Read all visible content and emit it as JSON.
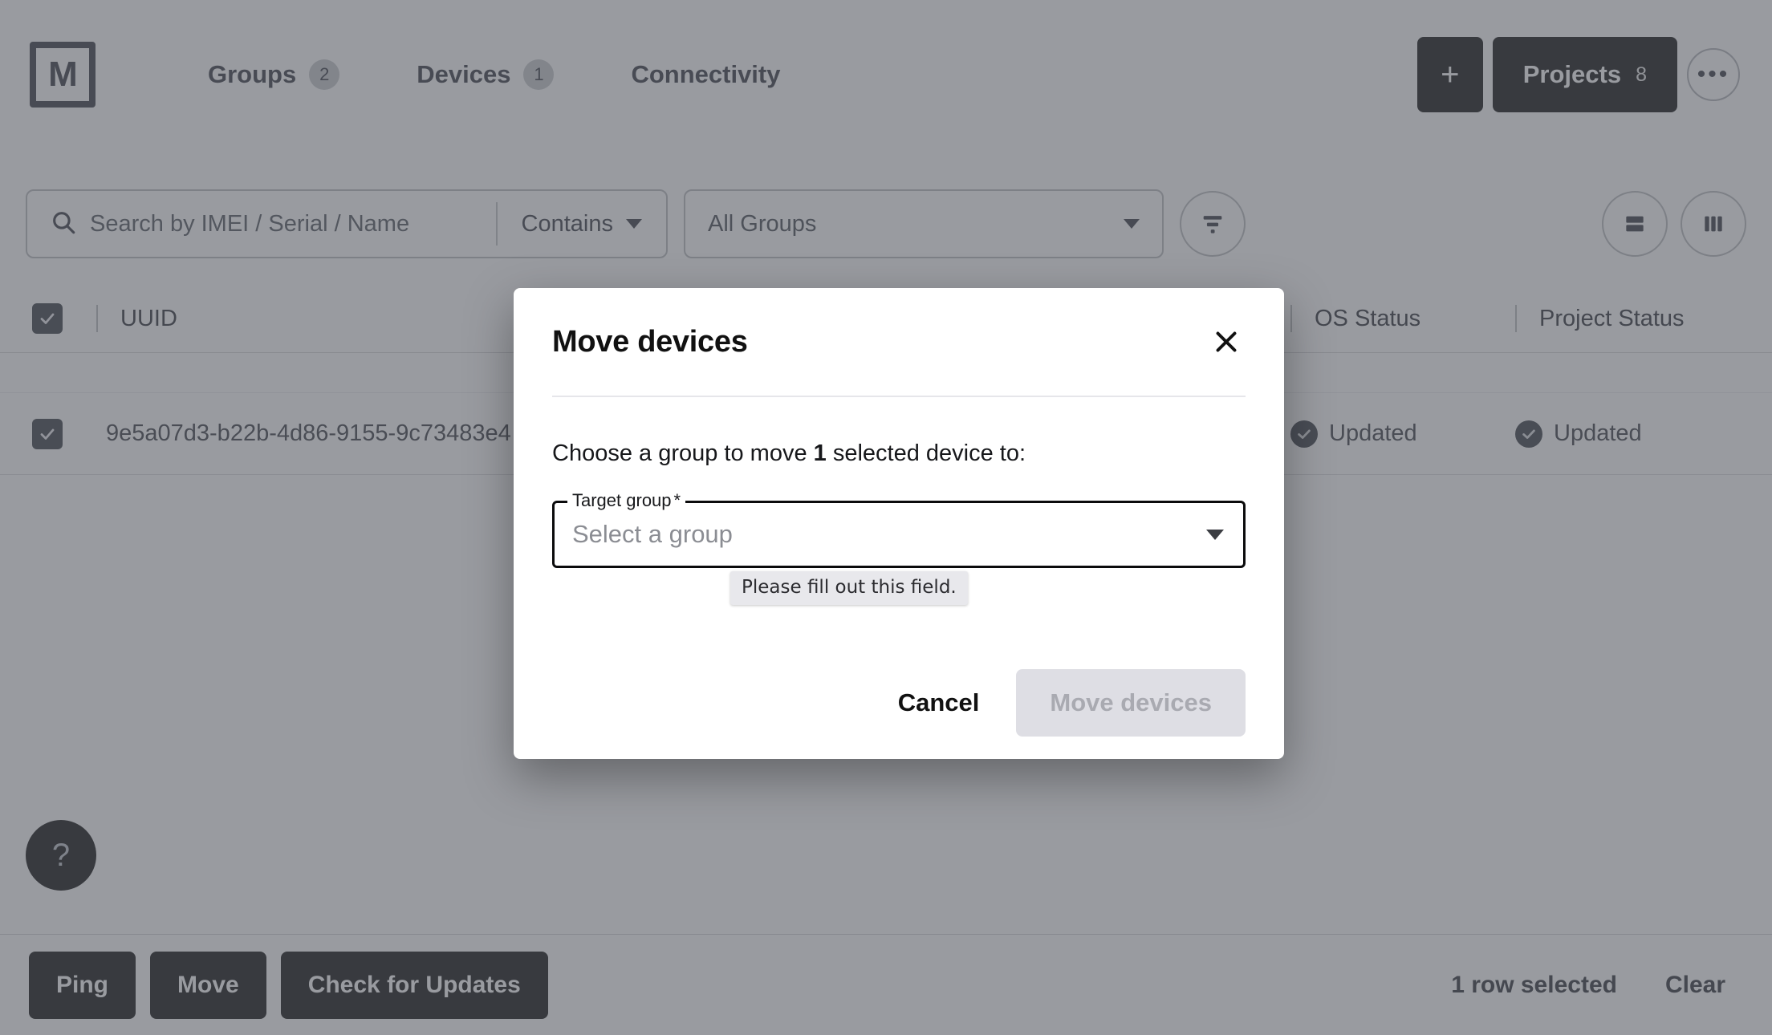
{
  "header": {
    "logo_text": "M",
    "tabs": [
      {
        "label": "Groups",
        "count": "2",
        "active": false
      },
      {
        "label": "Devices",
        "count": "1",
        "active": true
      },
      {
        "label": "Connectivity",
        "count": "",
        "active": false
      }
    ],
    "add_label": "+",
    "projects_label": "Projects",
    "projects_count": "8",
    "overflow_label": "•••"
  },
  "filters": {
    "search_placeholder": "Search by IMEI / Serial / Name",
    "search_value": "",
    "match_mode": "Contains",
    "group_filter": "All Groups"
  },
  "table": {
    "columns": [
      "UUID",
      "OS Status",
      "Project Status"
    ],
    "rows": [
      {
        "selected": true,
        "uuid": "9e5a07d3-b22b-4d86-9155-9c73483e4",
        "os_status": "Updated",
        "project_status": "Updated"
      }
    ]
  },
  "help": {
    "label": "?"
  },
  "bottom_bar": {
    "actions": [
      "Ping",
      "Move",
      "Check for Updates"
    ],
    "selection_text": "1 row selected",
    "clear_label": "Clear"
  },
  "modal": {
    "title": "Move devices",
    "close_label": "✕",
    "prompt_prefix": "Choose a group to move ",
    "prompt_count": "1",
    "prompt_suffix": " selected device to:",
    "field_label": "Target group",
    "field_required_mark": "*",
    "field_placeholder": "Select a group",
    "validation_tooltip": "Please fill out this field.",
    "cancel_label": "Cancel",
    "submit_label": "Move devices"
  },
  "colors": {
    "dark": "#000000",
    "ink": "#2b2f38",
    "scrim": "rgba(90,94,101,0.62)",
    "disabled_bg": "#dedee4",
    "disabled_fg": "#a9aab1",
    "tooltip_bg": "#e8e8ec"
  }
}
